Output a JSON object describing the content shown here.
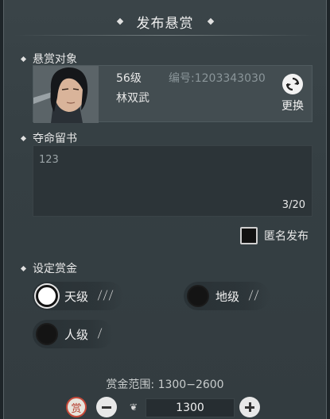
{
  "header": {
    "title": "发布悬赏"
  },
  "target_section": {
    "heading": "悬赏对象",
    "level": "56级",
    "name": "林双武",
    "serial": "编号:1203343030",
    "swap_label": "更换"
  },
  "message_section": {
    "heading": "夺命留书",
    "text": "123",
    "count": "3/20"
  },
  "anonymous": {
    "label": "匿名发布",
    "checked": false
  },
  "reward_section": {
    "heading": "设定赏金",
    "grades": [
      {
        "label": "天级",
        "blades": 3,
        "selected": true
      },
      {
        "label": "地级",
        "blades": 2,
        "selected": false
      },
      {
        "label": "人级",
        "blades": 1,
        "selected": false
      }
    ]
  },
  "range": {
    "text": "赏金范围: 1300−2600"
  },
  "amount": {
    "badge": "赏",
    "value": "1300"
  }
}
